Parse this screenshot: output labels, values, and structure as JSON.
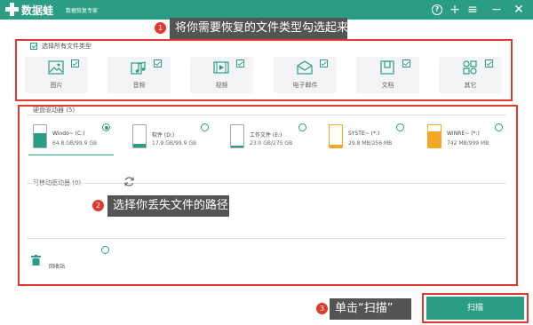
{
  "app": {
    "name": "数据蛙",
    "slogan": "数据恢复专家"
  },
  "callouts": [
    {
      "num": "1",
      "text": "将你需要恢复的文件类型勾选起来"
    },
    {
      "num": "2",
      "text": "选择你丢失文件的路径"
    },
    {
      "num": "3",
      "text": "单击“扫描”"
    }
  ],
  "file_types": {
    "select_all_label": "选择所有文件类型",
    "select_all_checked": true,
    "items": [
      {
        "label": "图片",
        "icon": "image-icon",
        "checked": true
      },
      {
        "label": "音频",
        "icon": "audio-icon",
        "checked": true
      },
      {
        "label": "视频",
        "icon": "video-icon",
        "checked": true
      },
      {
        "label": "电子邮件",
        "icon": "email-icon",
        "checked": true
      },
      {
        "label": "文档",
        "icon": "document-icon",
        "checked": true
      },
      {
        "label": "其它",
        "icon": "others-icon",
        "checked": true
      }
    ]
  },
  "hard_drives": {
    "title": "硬盘驱动器 (5)",
    "items": [
      {
        "name": "Windo~ (C:)",
        "size": "64.8 GB/99.9 GB",
        "selected": true,
        "used_fraction": 0.65,
        "color": "#2b9d84"
      },
      {
        "name": "软件 (D:)",
        "size": "17.9 GB/99.9 GB",
        "selected": false,
        "used_fraction": 0.18,
        "color": "#2b9d84"
      },
      {
        "name": "工作文件 (E:)",
        "size": "23.0 GB/275 GB",
        "selected": false,
        "used_fraction": 0.08,
        "color": "#2b9d84"
      },
      {
        "name": "SYSTE~ (*:)",
        "size": "29.8 MB/256 MB",
        "selected": false,
        "used_fraction": 0.12,
        "color": "#f5a623"
      },
      {
        "name": "WINRE~ (*:)",
        "size": "742 MB/999 MB",
        "selected": false,
        "used_fraction": 0.74,
        "color": "#f5a623"
      }
    ]
  },
  "removable_drives": {
    "title": "可移动驱动器 (0)"
  },
  "recycle_bin": {
    "label": "回收站",
    "selected": false
  },
  "scan_button": {
    "label": "扫描"
  },
  "colors": {
    "accent": "#2b9d84",
    "highlight": "#e0392f",
    "callout_bg": "#545454",
    "warning": "#f5a623"
  }
}
